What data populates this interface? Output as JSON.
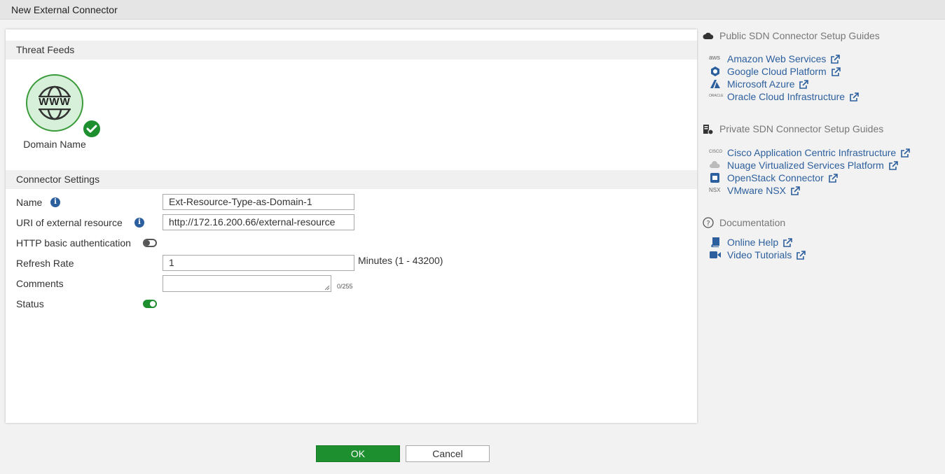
{
  "window": {
    "title": "New External Connector"
  },
  "threat_feeds": {
    "heading": "Threat Feeds",
    "selected_card": {
      "icon_text": "WWW",
      "label": "Domain Name"
    }
  },
  "connector_settings": {
    "heading": "Connector Settings",
    "name": {
      "label": "Name",
      "value": "Ext-Resource-Type-as-Domain-1"
    },
    "uri": {
      "label": "URI of external resource",
      "value": "http://172.16.200.66/external-resource"
    },
    "http_auth": {
      "label": "HTTP basic authentication",
      "enabled": false
    },
    "refresh_rate": {
      "label": "Refresh Rate",
      "value": "1",
      "unit": "Minutes (1 - 43200)"
    },
    "comments": {
      "label": "Comments",
      "value": "",
      "counter": "0/255"
    },
    "status": {
      "label": "Status",
      "enabled": true
    }
  },
  "sidebar": {
    "public": {
      "heading": "Public SDN Connector Setup Guides",
      "links": [
        {
          "label": "Amazon Web Services",
          "icon": "aws-icon",
          "icon_text": "aws"
        },
        {
          "label": "Google Cloud Platform",
          "icon": "gcp-icon"
        },
        {
          "label": "Microsoft Azure",
          "icon": "azure-icon"
        },
        {
          "label": "Oracle Cloud Infrastructure",
          "icon": "oracle-icon",
          "icon_text": "ORACLE"
        }
      ]
    },
    "private": {
      "heading": "Private SDN Connector Setup Guides",
      "links": [
        {
          "label": "Cisco Application Centric Infrastructure",
          "icon": "cisco-icon",
          "icon_text": "CISCO"
        },
        {
          "label": "Nuage Virtualized Services Platform",
          "icon": "nuage-icon"
        },
        {
          "label": "OpenStack Connector",
          "icon": "openstack-icon"
        },
        {
          "label": "VMware NSX",
          "icon": "nsx-icon",
          "icon_text": "NSX"
        }
      ]
    },
    "documentation": {
      "heading": "Documentation",
      "links": [
        {
          "label": "Online Help",
          "icon": "book-icon"
        },
        {
          "label": "Video Tutorials",
          "icon": "video-camera-icon"
        }
      ]
    }
  },
  "buttons": {
    "ok": "OK",
    "cancel": "Cancel"
  },
  "colors": {
    "accent_green": "#1d8f2f",
    "link_blue": "#2c5f9e",
    "info_blue": "#2c5f9e"
  }
}
